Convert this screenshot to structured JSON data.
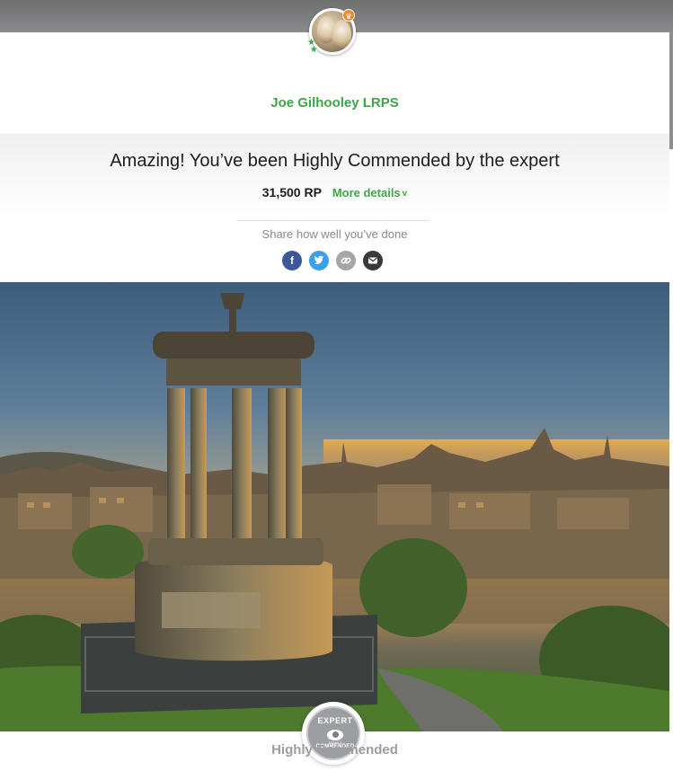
{
  "user": {
    "name": "Joe Gilhooley LRPS"
  },
  "result": {
    "headline": "Amazing! You’ve been Highly Commended by the expert",
    "points": "31,500 RP",
    "more_details_label": "More details"
  },
  "share": {
    "label": "Share how well you’ve done",
    "icons": [
      "facebook-icon",
      "twitter-icon",
      "link-icon",
      "mail-icon"
    ]
  },
  "badge": {
    "top_text": "EXPERT",
    "mid_text": "HIGHLY",
    "bottom_text": "COMMENDED"
  },
  "award": {
    "label": "Highly Commended"
  },
  "colors": {
    "accent_green": "#3fa546",
    "facebook": "#3b5998",
    "twitter": "#3aa0e8",
    "link": "#a6a6a6",
    "mail": "#3a3a3a",
    "badge_grey": "#9c9ea1"
  }
}
